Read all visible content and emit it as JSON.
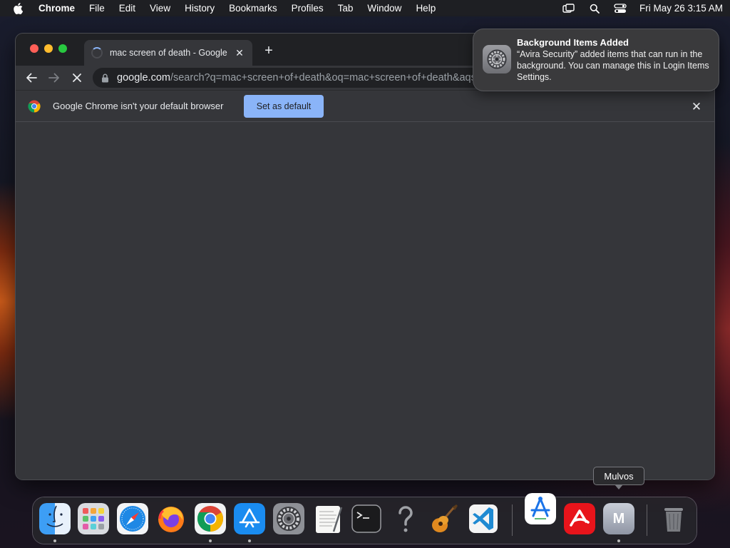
{
  "menubar": {
    "app_name": "Chrome",
    "items": [
      "File",
      "Edit",
      "View",
      "History",
      "Bookmarks",
      "Profiles",
      "Tab",
      "Window",
      "Help"
    ],
    "clock": "Fri May 26  3:15 AM",
    "status_icons": [
      "screen-mirroring-icon",
      "spotlight-search-icon",
      "control-center-icon"
    ]
  },
  "browser": {
    "tab_title": "mac screen of death - Google Search",
    "url_host": "google.com",
    "url_path": "/search?q=mac+screen+of+death&oq=mac+screen+of+death&aqs=chrome",
    "infobar_message": "Google Chrome isn't your default browser",
    "set_default_label": "Set as default"
  },
  "notification": {
    "title": "Background Items Added",
    "body": "“Avira Security” added items that can run in the background. You can manage this in Login Items Settings."
  },
  "dock": {
    "tooltip": "Mulvos",
    "apps": [
      {
        "name": "Finder",
        "icon": "finder-icon",
        "running": true
      },
      {
        "name": "Launchpad",
        "icon": "launchpad-icon",
        "running": false
      },
      {
        "name": "Safari",
        "icon": "safari-icon",
        "running": false
      },
      {
        "name": "Firefox",
        "icon": "firefox-icon",
        "running": false
      },
      {
        "name": "Google Chrome",
        "icon": "chrome-icon",
        "running": true
      },
      {
        "name": "App Store",
        "icon": "app-store-icon",
        "running": true
      },
      {
        "name": "System Settings",
        "icon": "system-settings-icon",
        "running": false
      },
      {
        "name": "TextEdit",
        "icon": "textedit-icon",
        "running": false
      },
      {
        "name": "Terminal",
        "icon": "terminal-icon",
        "running": false
      },
      {
        "name": "Help",
        "icon": "question-mark-icon",
        "running": false
      },
      {
        "name": "GarageBand",
        "icon": "garageband-icon",
        "running": false
      },
      {
        "name": "Visual Studio Code",
        "icon": "vscode-icon",
        "running": false
      },
      {
        "name": "Xcode Instruments",
        "icon": "instruments-icon",
        "running": false
      },
      {
        "name": "Avira Security",
        "icon": "avira-icon",
        "running": false
      },
      {
        "name": "Mulvos",
        "icon": "mulvos-icon",
        "label": "M",
        "running": true
      },
      {
        "name": "Trash",
        "icon": "trash-icon",
        "running": false
      }
    ]
  },
  "colors": {
    "accent": "#8ab4f8",
    "window_bg": "#35363a",
    "tabstrip_bg": "#202124"
  }
}
